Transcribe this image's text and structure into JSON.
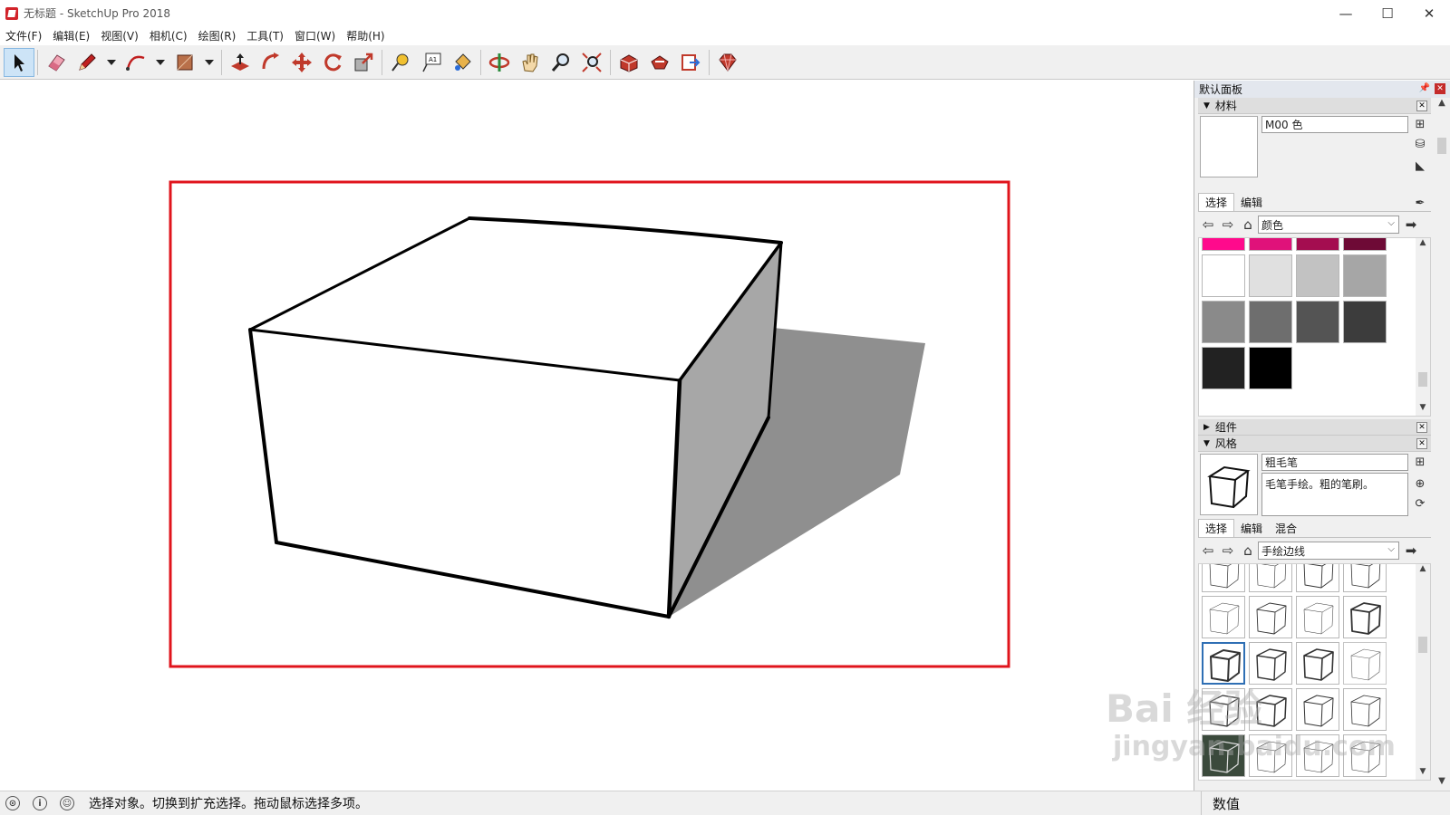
{
  "window": {
    "title": "无标题 - SketchUp Pro 2018",
    "controls": {
      "minimize": "—",
      "maximize": "☐",
      "close": "✕"
    }
  },
  "menu": [
    "文件(F)",
    "编辑(E)",
    "视图(V)",
    "相机(C)",
    "绘图(R)",
    "工具(T)",
    "窗口(W)",
    "帮助(H)"
  ],
  "toolbar": {
    "tools": [
      "select-icon",
      "eraser-icon",
      "pencil-icon",
      "arc-icon",
      "rectangle-icon",
      "push-pull-icon",
      "follow-me-icon",
      "move-icon",
      "rotate-icon",
      "scale-icon",
      "tape-measure-icon",
      "text-icon",
      "paint-bucket-icon",
      "orbit-icon",
      "pan-icon",
      "zoom-icon",
      "zoom-extents-icon",
      "warehouse-icon",
      "extension-warehouse-icon",
      "send-to-layout-icon",
      "ruby-icon"
    ],
    "active_tool": "select-icon"
  },
  "statusbar": {
    "message": "选择对象。切换到扩充选择。拖动鼠标选择多项。",
    "vcb_label": "数值"
  },
  "tray": {
    "title": "默认面板",
    "materials": {
      "header": "材料",
      "name": "M00 色",
      "tabs": [
        "选择",
        "编辑"
      ],
      "library": "颜色",
      "swatch_rows": [
        [
          "#ff0a8c",
          "#e0127a",
          "#a40d50",
          "#6e0a36"
        ],
        [
          "#ffffff",
          "#e0e0e0",
          "#c2c2c2",
          "#a6a6a6"
        ],
        [
          "#8a8a8a",
          "#6e6e6e",
          "#545454",
          "#3c3c3c"
        ],
        [
          "#222222",
          "#000000"
        ]
      ]
    },
    "components": {
      "header": "组件"
    },
    "styles": {
      "header": "风格",
      "name": "粗毛笔",
      "description": "毛笔手绘。粗的笔刷。",
      "tabs": [
        "选择",
        "编辑",
        "混合"
      ],
      "library": "手绘边线"
    }
  },
  "watermark": {
    "line1": "Bai 经验",
    "line2": "jingyan.baidu.com"
  }
}
